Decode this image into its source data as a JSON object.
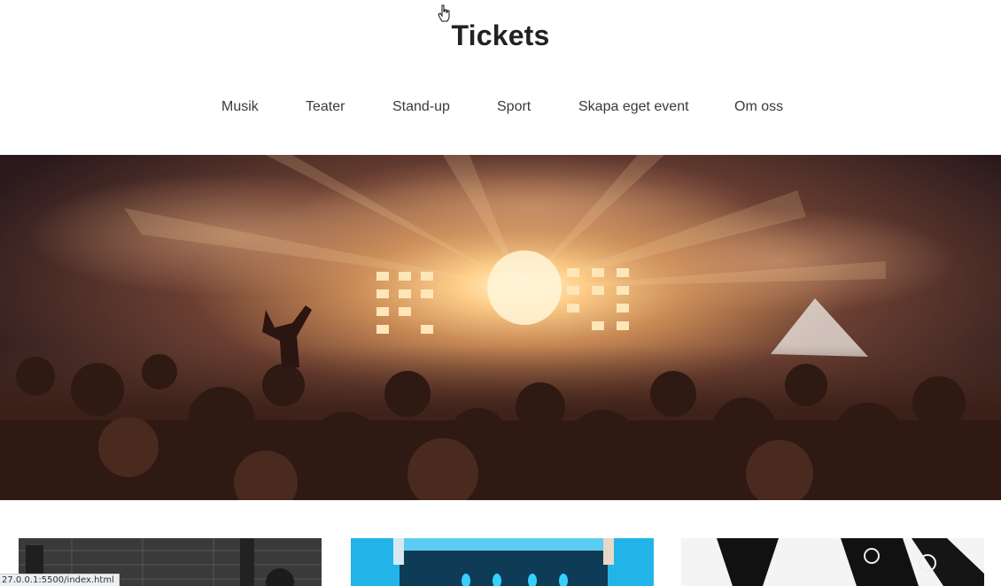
{
  "header": {
    "title": "Tickets"
  },
  "nav": {
    "items": [
      {
        "label": "Musik"
      },
      {
        "label": "Teater"
      },
      {
        "label": "Stand-up"
      },
      {
        "label": "Sport"
      },
      {
        "label": "Skapa eget event"
      },
      {
        "label": "Om oss"
      }
    ]
  },
  "hero": {
    "image": "concert-crowd-image"
  },
  "cards": [
    {
      "image": "band-stage-image"
    },
    {
      "image": "blue-concert-stage-image"
    },
    {
      "image": "sports-players-image"
    }
  ],
  "status_bar": {
    "url": "27.0.0.1:5500/index.html"
  },
  "colors": {
    "title": "#222222",
    "nav_text": "#3a3a3a",
    "hero_glow": "#ffcf8a"
  }
}
